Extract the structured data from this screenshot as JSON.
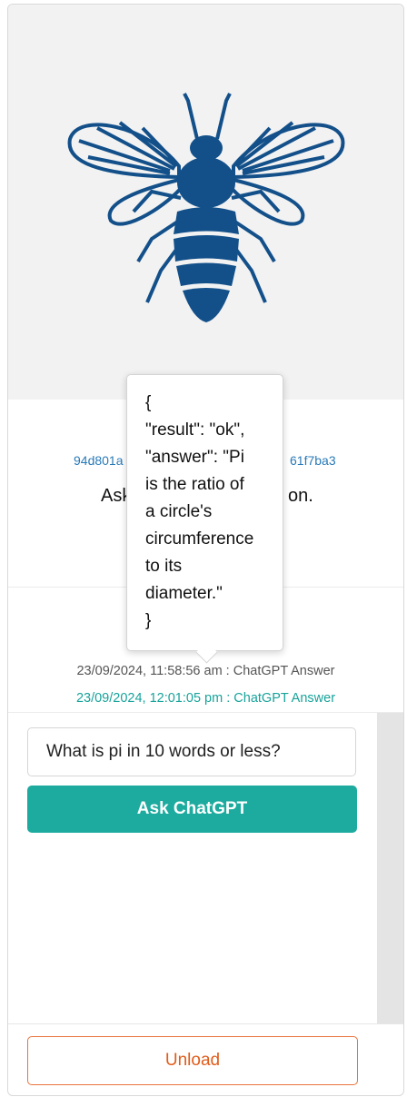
{
  "logo": {
    "icon": "bee-icon",
    "color": "#13508a"
  },
  "item": {
    "id_left": "94d801a",
    "id_right": "61f7ba3",
    "instruction_left": "Ask",
    "instruction_right": "on."
  },
  "log": [
    {
      "text": "23/09/2024, 11:58:56 am : ChatGPT Answer"
    },
    {
      "text": "23/09/2024, 12:01:05 pm : ChatGPT Answer"
    }
  ],
  "question": {
    "value": "What is pi in 10 words or less?"
  },
  "buttons": {
    "ask": "Ask ChatGPT",
    "unload": "Unload"
  },
  "tooltip": {
    "lines": [
      "{",
      "\"result\": \"ok\",",
      "\"answer\": \"Pi",
      "is the ratio of",
      "a circle's",
      "circumference",
      "to its",
      "diameter.\"",
      "}"
    ]
  },
  "colors": {
    "accent": "#1dab9f",
    "link": "#2a7ab8",
    "unload": "#e05d1c",
    "bee": "#13508a"
  }
}
